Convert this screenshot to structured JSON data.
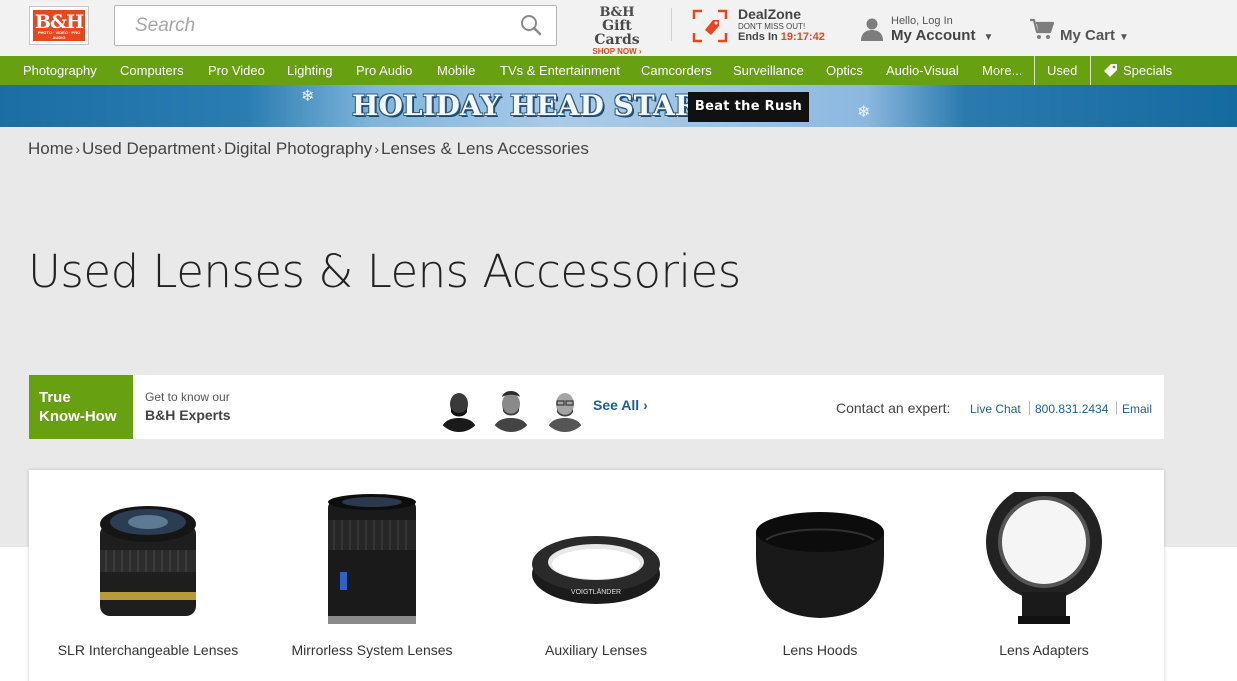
{
  "header": {
    "logo_text": "B&H",
    "logo_sub": "PHOTO · VIDEO · PRO AUDIO",
    "search_placeholder": "Search",
    "gift": {
      "line1": "B&H",
      "line2": "Gift Cards",
      "cta": "SHOP NOW ›"
    },
    "dealzone": {
      "title": "DealZone",
      "sub": "DON'T MISS OUT!",
      "ends_label": "Ends In",
      "time": "19:17:42"
    },
    "account": {
      "greeting": "Hello, Log In",
      "label": "My Account",
      "caret": "▼"
    },
    "cart": {
      "label": "My Cart",
      "caret": "▼"
    }
  },
  "nav": {
    "items": [
      "Photography",
      "Computers",
      "Pro Video",
      "Lighting",
      "Pro Audio",
      "Mobile",
      "TVs & Entertainment",
      "Camcorders",
      "Surveillance",
      "Optics",
      "Audio-Visual",
      "More..."
    ],
    "used": "Used",
    "specials": "Specials"
  },
  "banner": {
    "title": "HOLIDAY HEAD START",
    "button": "Beat the Rush"
  },
  "breadcrumb": {
    "items": [
      "Home",
      "Used Department",
      "Digital Photography",
      "Lenses & Lens Accessories"
    ],
    "sep": "›"
  },
  "page_title": "Used Lenses & Lens Accessories",
  "experts": {
    "badge_line1": "True",
    "badge_line2": "Know-How",
    "intro": "Get to know our",
    "intro_bold": "B&H Experts",
    "see_all": "See All",
    "see_all_chevron": "›",
    "contact_label": "Contact an expert:",
    "live_chat": "Live Chat",
    "phone": "800.831.2434",
    "email": "Email"
  },
  "categories": [
    {
      "label": "SLR Interchangeable Lenses",
      "icon": "dslr-lens-icon"
    },
    {
      "label": "Mirrorless System Lenses",
      "icon": "mirrorless-lens-icon"
    },
    {
      "label": "Auxiliary Lenses",
      "icon": "lens-ring-icon"
    },
    {
      "label": "Lens Hoods",
      "icon": "lens-hood-icon"
    },
    {
      "label": "Lens Adapters",
      "icon": "lens-adapter-icon"
    }
  ],
  "colors": {
    "brand_green": "#67a112",
    "brand_orange": "#e8471e",
    "link_blue": "#1f5e99"
  }
}
